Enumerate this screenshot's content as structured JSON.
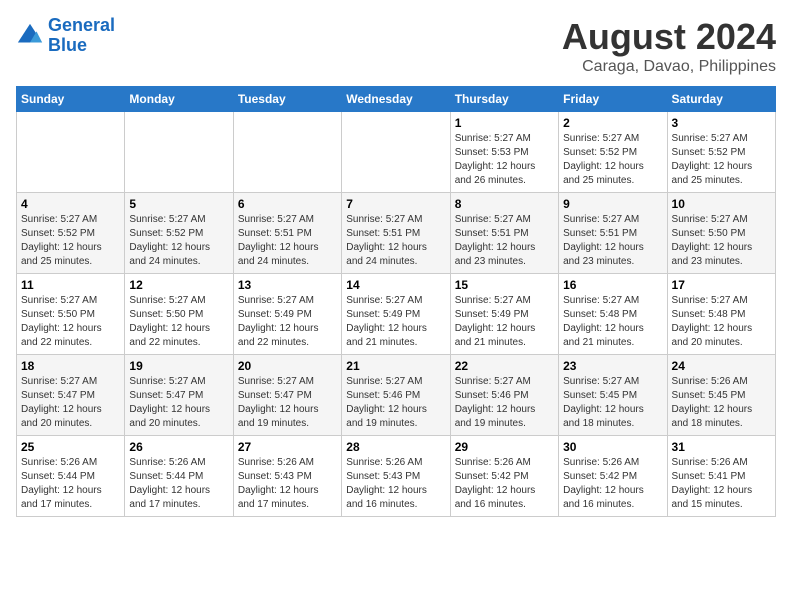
{
  "header": {
    "logo_line1": "General",
    "logo_line2": "Blue",
    "month_title": "August 2024",
    "subtitle": "Caraga, Davao, Philippines"
  },
  "days_of_week": [
    "Sunday",
    "Monday",
    "Tuesday",
    "Wednesday",
    "Thursday",
    "Friday",
    "Saturday"
  ],
  "weeks": [
    [
      {
        "day": "",
        "info": ""
      },
      {
        "day": "",
        "info": ""
      },
      {
        "day": "",
        "info": ""
      },
      {
        "day": "",
        "info": ""
      },
      {
        "day": "1",
        "info": "Sunrise: 5:27 AM\nSunset: 5:53 PM\nDaylight: 12 hours and 26 minutes."
      },
      {
        "day": "2",
        "info": "Sunrise: 5:27 AM\nSunset: 5:52 PM\nDaylight: 12 hours and 25 minutes."
      },
      {
        "day": "3",
        "info": "Sunrise: 5:27 AM\nSunset: 5:52 PM\nDaylight: 12 hours and 25 minutes."
      }
    ],
    [
      {
        "day": "4",
        "info": "Sunrise: 5:27 AM\nSunset: 5:52 PM\nDaylight: 12 hours and 25 minutes."
      },
      {
        "day": "5",
        "info": "Sunrise: 5:27 AM\nSunset: 5:52 PM\nDaylight: 12 hours and 24 minutes."
      },
      {
        "day": "6",
        "info": "Sunrise: 5:27 AM\nSunset: 5:51 PM\nDaylight: 12 hours and 24 minutes."
      },
      {
        "day": "7",
        "info": "Sunrise: 5:27 AM\nSunset: 5:51 PM\nDaylight: 12 hours and 24 minutes."
      },
      {
        "day": "8",
        "info": "Sunrise: 5:27 AM\nSunset: 5:51 PM\nDaylight: 12 hours and 23 minutes."
      },
      {
        "day": "9",
        "info": "Sunrise: 5:27 AM\nSunset: 5:51 PM\nDaylight: 12 hours and 23 minutes."
      },
      {
        "day": "10",
        "info": "Sunrise: 5:27 AM\nSunset: 5:50 PM\nDaylight: 12 hours and 23 minutes."
      }
    ],
    [
      {
        "day": "11",
        "info": "Sunrise: 5:27 AM\nSunset: 5:50 PM\nDaylight: 12 hours and 22 minutes."
      },
      {
        "day": "12",
        "info": "Sunrise: 5:27 AM\nSunset: 5:50 PM\nDaylight: 12 hours and 22 minutes."
      },
      {
        "day": "13",
        "info": "Sunrise: 5:27 AM\nSunset: 5:49 PM\nDaylight: 12 hours and 22 minutes."
      },
      {
        "day": "14",
        "info": "Sunrise: 5:27 AM\nSunset: 5:49 PM\nDaylight: 12 hours and 21 minutes."
      },
      {
        "day": "15",
        "info": "Sunrise: 5:27 AM\nSunset: 5:49 PM\nDaylight: 12 hours and 21 minutes."
      },
      {
        "day": "16",
        "info": "Sunrise: 5:27 AM\nSunset: 5:48 PM\nDaylight: 12 hours and 21 minutes."
      },
      {
        "day": "17",
        "info": "Sunrise: 5:27 AM\nSunset: 5:48 PM\nDaylight: 12 hours and 20 minutes."
      }
    ],
    [
      {
        "day": "18",
        "info": "Sunrise: 5:27 AM\nSunset: 5:47 PM\nDaylight: 12 hours and 20 minutes."
      },
      {
        "day": "19",
        "info": "Sunrise: 5:27 AM\nSunset: 5:47 PM\nDaylight: 12 hours and 20 minutes."
      },
      {
        "day": "20",
        "info": "Sunrise: 5:27 AM\nSunset: 5:47 PM\nDaylight: 12 hours and 19 minutes."
      },
      {
        "day": "21",
        "info": "Sunrise: 5:27 AM\nSunset: 5:46 PM\nDaylight: 12 hours and 19 minutes."
      },
      {
        "day": "22",
        "info": "Sunrise: 5:27 AM\nSunset: 5:46 PM\nDaylight: 12 hours and 19 minutes."
      },
      {
        "day": "23",
        "info": "Sunrise: 5:27 AM\nSunset: 5:45 PM\nDaylight: 12 hours and 18 minutes."
      },
      {
        "day": "24",
        "info": "Sunrise: 5:26 AM\nSunset: 5:45 PM\nDaylight: 12 hours and 18 minutes."
      }
    ],
    [
      {
        "day": "25",
        "info": "Sunrise: 5:26 AM\nSunset: 5:44 PM\nDaylight: 12 hours and 17 minutes."
      },
      {
        "day": "26",
        "info": "Sunrise: 5:26 AM\nSunset: 5:44 PM\nDaylight: 12 hours and 17 minutes."
      },
      {
        "day": "27",
        "info": "Sunrise: 5:26 AM\nSunset: 5:43 PM\nDaylight: 12 hours and 17 minutes."
      },
      {
        "day": "28",
        "info": "Sunrise: 5:26 AM\nSunset: 5:43 PM\nDaylight: 12 hours and 16 minutes."
      },
      {
        "day": "29",
        "info": "Sunrise: 5:26 AM\nSunset: 5:42 PM\nDaylight: 12 hours and 16 minutes."
      },
      {
        "day": "30",
        "info": "Sunrise: 5:26 AM\nSunset: 5:42 PM\nDaylight: 12 hours and 16 minutes."
      },
      {
        "day": "31",
        "info": "Sunrise: 5:26 AM\nSunset: 5:41 PM\nDaylight: 12 hours and 15 minutes."
      }
    ]
  ]
}
